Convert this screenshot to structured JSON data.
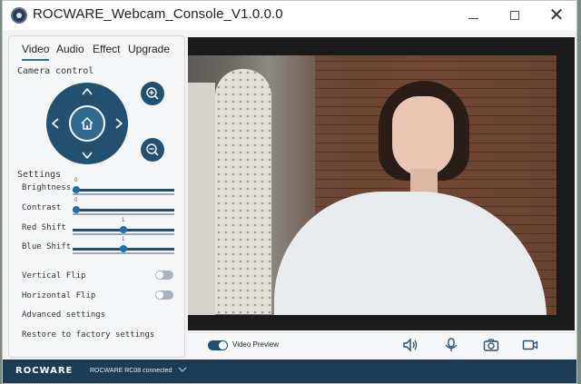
{
  "window": {
    "title": "ROCWARE_Webcam_Console_V1.0.0.0",
    "minimize_glyph": "—",
    "close_glyph": "✕"
  },
  "tabs": [
    {
      "label": "Video",
      "active": true
    },
    {
      "label": "Audio",
      "active": false
    },
    {
      "label": "Effect",
      "active": false
    },
    {
      "label": "Upgrade",
      "active": false
    }
  ],
  "camera_control": {
    "title": "Camera control",
    "zoom_in_icon": "zoom-in-icon",
    "zoom_out_icon": "zoom-out-icon"
  },
  "settings": {
    "title": "Settings",
    "sliders": [
      {
        "label": "Brightness",
        "value": "0",
        "level": 0.0
      },
      {
        "label": "Contrast",
        "value": "0",
        "level": 0.0
      },
      {
        "label": "Red Shift",
        "value": "1",
        "level": 0.5
      },
      {
        "label": "Blue Shift",
        "value": "1",
        "level": 0.5
      }
    ],
    "toggles": [
      {
        "label": "Vertical Flip",
        "on": false
      },
      {
        "label": "Horizontal Flip",
        "on": false
      }
    ],
    "links": [
      {
        "label": "Advanced settings"
      },
      {
        "label": "Restore to factory settings"
      }
    ]
  },
  "preview_bar": {
    "video_preview_label": "Video Preview",
    "video_preview_on": true,
    "icons": [
      "speaker-icon",
      "microphone-icon",
      "camera-icon",
      "video-record-icon"
    ]
  },
  "status": {
    "brand": "ROCWARE",
    "connection": "ROCWARE RC08 connected",
    "colors": {
      "bar": "#1d3b52",
      "accent": "#1f4f72"
    }
  }
}
